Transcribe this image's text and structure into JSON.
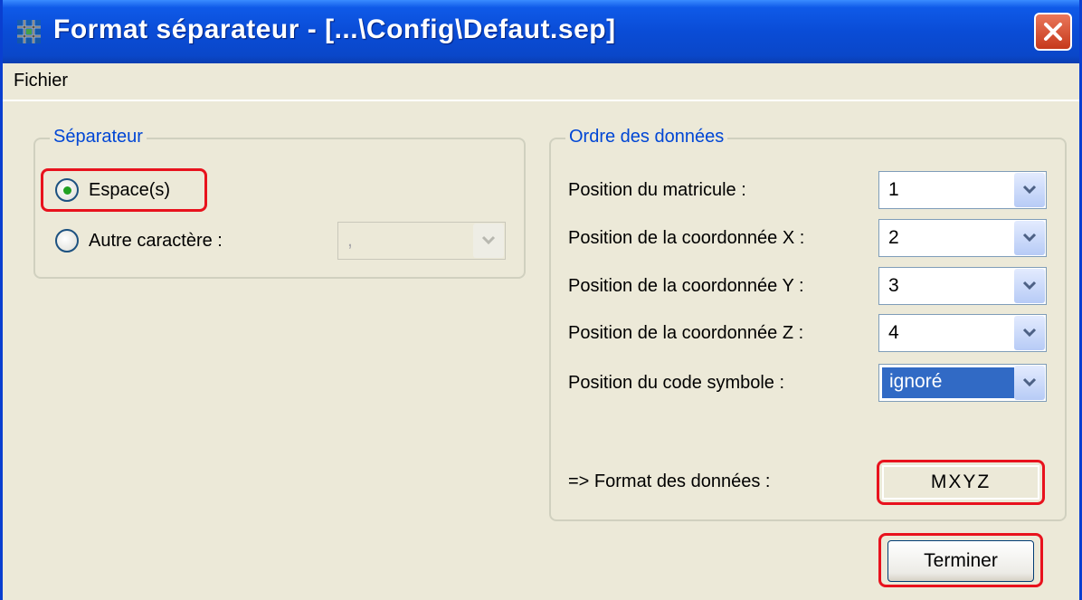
{
  "window": {
    "title": "Format séparateur - [...\\Config\\Defaut.sep]",
    "app_icon": "grid-hash-icon",
    "close_icon": "close-icon",
    "title_bar_color": "#0A4CD6"
  },
  "menu": {
    "items": [
      {
        "label": "Fichier"
      }
    ]
  },
  "separator_group": {
    "title": "Séparateur",
    "options": [
      {
        "label": "Espace(s)",
        "selected": true
      },
      {
        "label": "Autre caractère :",
        "selected": false
      }
    ],
    "other_char_value": ","
  },
  "data_order_group": {
    "title": "Ordre des données",
    "fields": [
      {
        "label": "Position du matricule :",
        "value": "1"
      },
      {
        "label": "Position de la coordonnée X :",
        "value": "2"
      },
      {
        "label": "Position de la coordonnée Y :",
        "value": "3"
      },
      {
        "label": "Position de la coordonnée Z :",
        "value": "4"
      },
      {
        "label": "Position du code symbole :",
        "value": "ignoré"
      }
    ],
    "format_label": "=> Format des données :",
    "format_value": "MXYZ"
  },
  "buttons": {
    "finish": "Terminer"
  },
  "annotations": {
    "highlight_color": "#E8121D"
  }
}
